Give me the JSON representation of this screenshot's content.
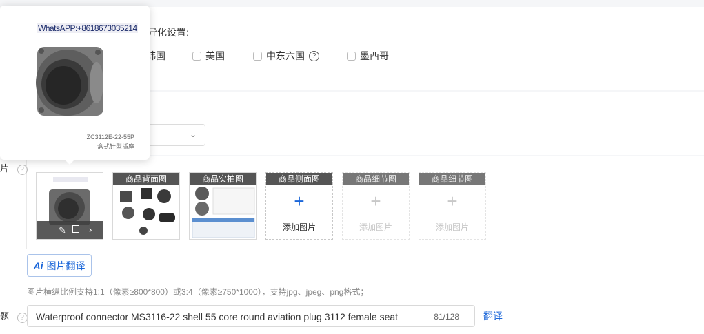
{
  "diff_settings": {
    "label_partial": "差异化设置:",
    "countries": [
      {
        "label": "韩国",
        "partial": "韩国"
      },
      {
        "label": "美国"
      },
      {
        "label": "中东六国"
      },
      {
        "label": "墨西哥"
      }
    ]
  },
  "popup": {
    "watermark": "WhatsAPP:+8618673035214",
    "model": "ZC3112E-22-55P",
    "desc": "盒式针型插座"
  },
  "images": {
    "section_label_partial": "片",
    "slots": [
      {
        "tag": "",
        "type": "main"
      },
      {
        "tag": "商品背面图",
        "type": "photo-back"
      },
      {
        "tag": "商品实拍图",
        "type": "photo-real"
      },
      {
        "tag": "商品侧面图",
        "type": "add",
        "add_label": "添加图片"
      },
      {
        "tag": "商品细节图",
        "type": "add-disabled",
        "add_label": "添加图片"
      },
      {
        "tag": "商品细节图",
        "type": "add-disabled",
        "add_label": "添加图片"
      }
    ],
    "translate_button": "图片翻译",
    "ai_badge": "Ai",
    "hint": "图片横纵比例支持1:1（像素≥800*800）或3:4（像素≥750*1000），支持jpg、jpeg、png格式；"
  },
  "title_field": {
    "label_partial": "题",
    "value": "Waterproof connector MS3116-22 shell 55 core round aviation plug 3112 female seat",
    "count": "81/128",
    "translate_link": "翻译"
  },
  "colors": {
    "accent": "#1a66d9",
    "tag_bg": "#555555"
  }
}
